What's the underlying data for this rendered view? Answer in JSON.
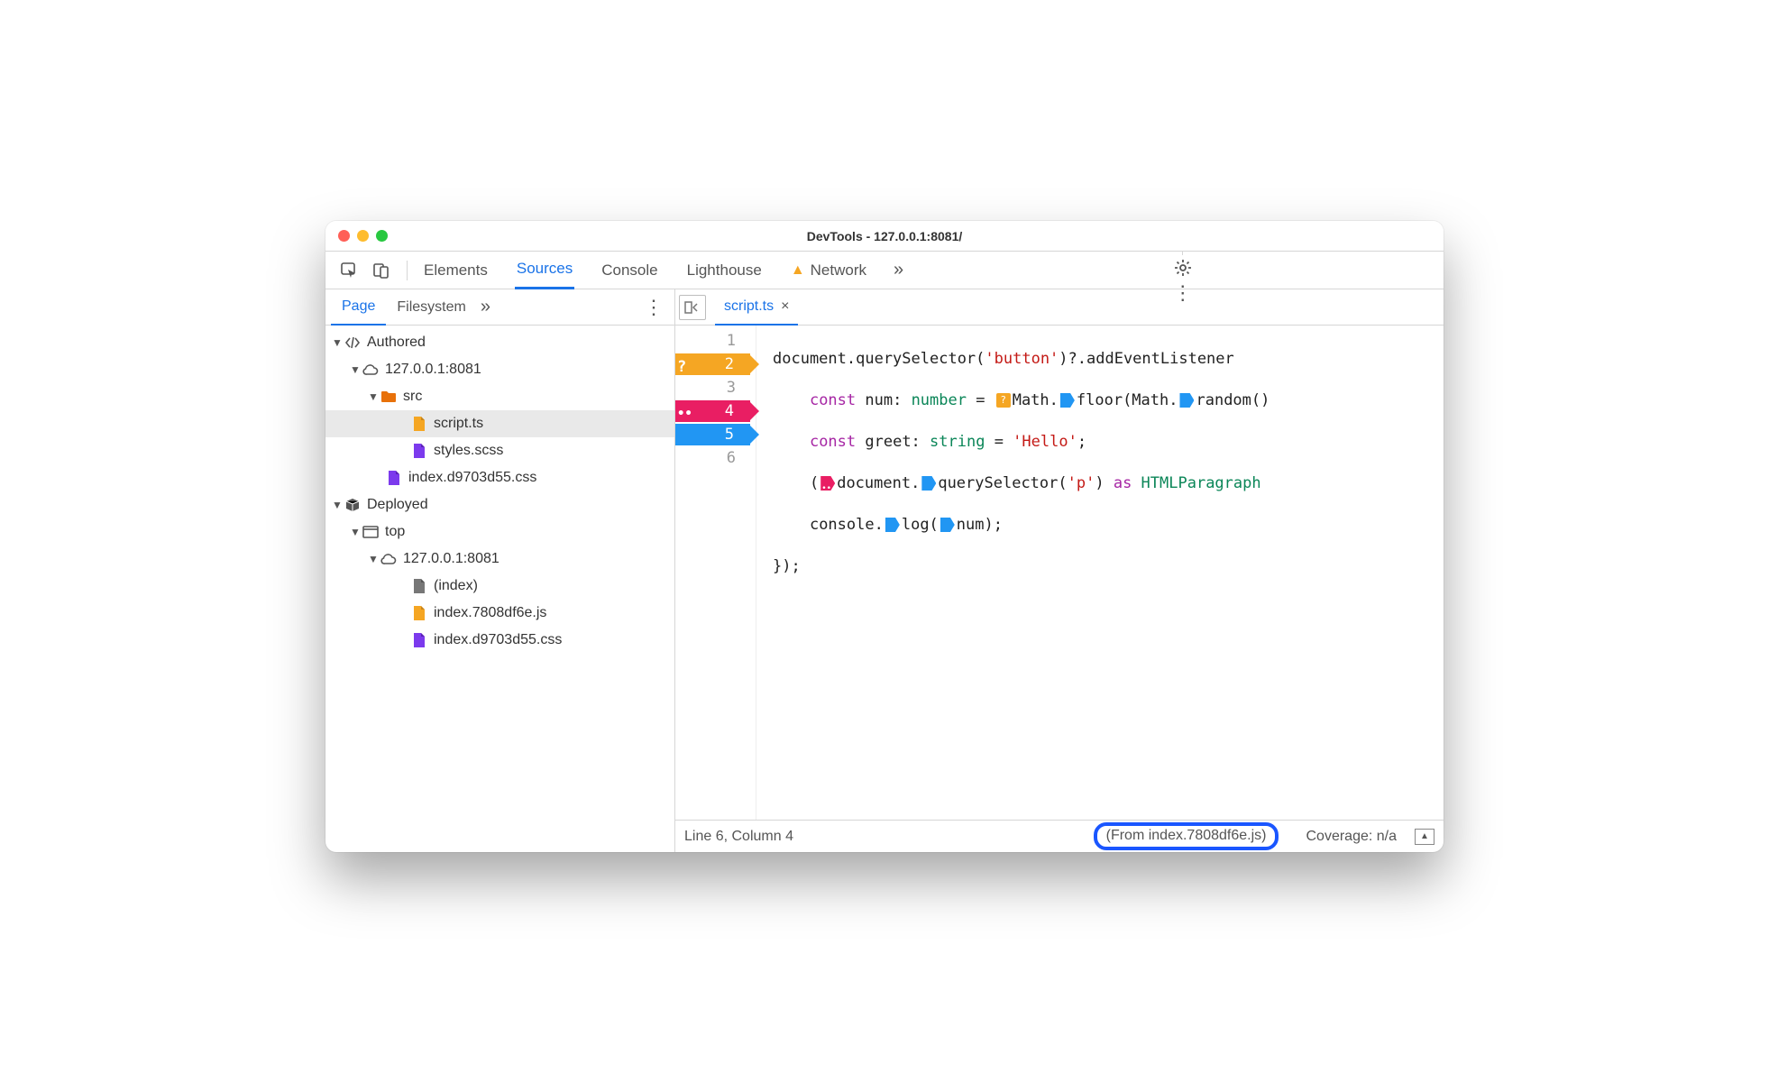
{
  "window": {
    "title": "DevTools - 127.0.0.1:8081/"
  },
  "toolbar": {
    "tabs": {
      "elements": "Elements",
      "sources": "Sources",
      "console": "Console",
      "lighthouse": "Lighthouse",
      "network": "Network"
    },
    "more_label": "»"
  },
  "left_panel": {
    "tabs": {
      "page": "Page",
      "filesystem": "Filesystem",
      "more": "»"
    },
    "tree": {
      "authored": "Authored",
      "host1": "127.0.0.1:8081",
      "src_folder": "src",
      "script_ts": "script.ts",
      "styles_scss": "styles.scss",
      "index_css_auth": "index.d9703d55.css",
      "deployed": "Deployed",
      "top": "top",
      "host2": "127.0.0.1:8081",
      "index_html": "(index)",
      "index_js": "index.7808df6e.js",
      "index_css_dep": "index.d9703d55.css"
    }
  },
  "editor": {
    "tab_name": "script.ts",
    "line_numbers": [
      "1",
      "2",
      "3",
      "4",
      "5",
      "6"
    ],
    "code": {
      "l1a": "document.querySelector(",
      "l1b": "'button'",
      "l1c": ")?.addEventListener",
      "l2a": "const",
      "l2b": " num: ",
      "l2c": "number",
      "l2d": " = ",
      "l2e": "Math.",
      "l2f": "floor(Math.",
      "l2g": "random()",
      "l3a": "const",
      "l3b": " greet: ",
      "l3c": "string",
      "l3d": " = ",
      "l3e": "'Hello'",
      "l3f": ";",
      "l4a": "(",
      "l4b": "document.",
      "l4c": "querySelector(",
      "l4d": "'p'",
      "l4e": ") ",
      "l4f": "as",
      "l4g": " HTMLParagraph",
      "l5a": "console.",
      "l5b": "log(",
      "l5c": "num);",
      "l6": "});"
    },
    "breakpoints": {
      "l2": {
        "style": "orange",
        "badge": "?"
      },
      "l4": {
        "style": "pink",
        "badge": ".."
      },
      "l5": {
        "style": "blue"
      }
    }
  },
  "statusbar": {
    "cursor": "Line 6, Column 4",
    "from_prefix": "(From ",
    "from_link": "index.7808df6e.js",
    "from_suffix": ")",
    "coverage": "Coverage: n/a"
  }
}
